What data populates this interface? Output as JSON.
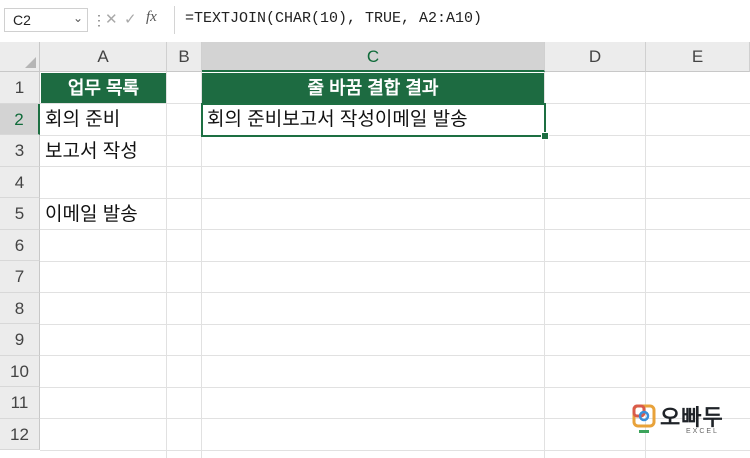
{
  "formula_bar": {
    "name_box": "C2",
    "formula": "=TEXTJOIN(CHAR(10), TRUE, A2:A10)",
    "icons": [
      "cancel-icon",
      "enter-icon",
      "function-icon"
    ]
  },
  "columns": [
    "A",
    "B",
    "C",
    "D",
    "E"
  ],
  "selected_column": "C",
  "rows": [
    "1",
    "2",
    "3",
    "4",
    "5",
    "6",
    "7",
    "8",
    "9",
    "10",
    "11",
    "12"
  ],
  "selected_row": "2",
  "cells": {
    "A1": "업무 목록",
    "A2": "회의 준비",
    "A3": "보고서 작성",
    "A4": "",
    "A5": "이메일 발송",
    "C1": "줄 바꿈 결합 결과",
    "C2": "회의 준비보고서 작성이메일 발송"
  },
  "colors": {
    "header_fill": "#1d6b41",
    "selection": "#1d6f42"
  },
  "watermark": {
    "brand": "오빠두",
    "sub": "EXCEL"
  }
}
